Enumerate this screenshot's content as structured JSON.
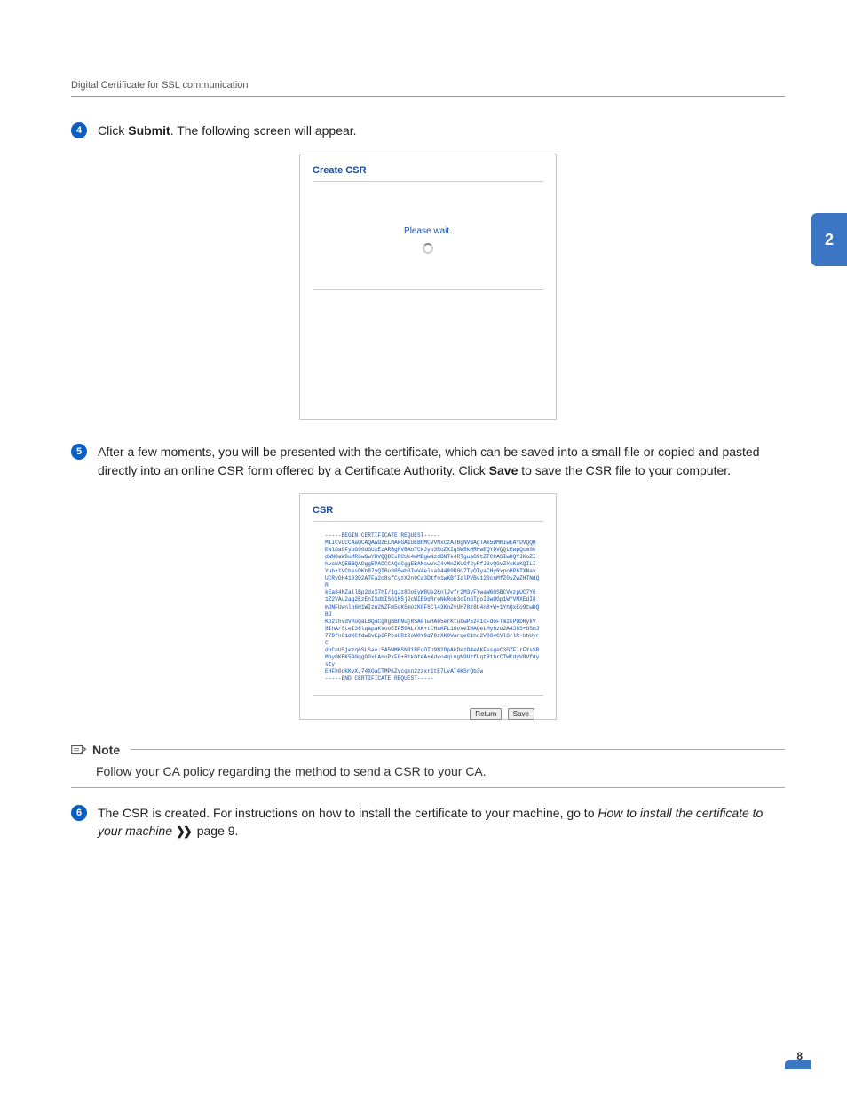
{
  "header": {
    "section_title": "Digital Certificate for SSL communication"
  },
  "side_tab": {
    "label": "2"
  },
  "steps": {
    "s4": {
      "num": "4",
      "pre": "Click ",
      "bold": "Submit",
      "post": ". The following screen will appear."
    },
    "s5": {
      "num": "5",
      "text_a": "After a few moments, you will be presented with the certificate, which can be saved into a small file or copied and pasted directly into an online CSR form offered by a Certificate Authority. Click ",
      "bold": "Save",
      "text_b": " to save the CSR file to your computer."
    },
    "s6": {
      "num": "6",
      "text_a": "The CSR is created. For instructions on how to install the certificate to your machine, go to ",
      "italic_a": "How to install the certificate to your machine",
      "post": " page 9."
    }
  },
  "screenshot1": {
    "title": "Create CSR",
    "wait": "Please wait."
  },
  "screenshot2": {
    "title": "CSR",
    "csr_lines": [
      "-----BEGIN CERTIFICATE REQUEST-----",
      "MIICvDCCAaQCAQAwdzELMAkGA1UEBhMCVVMxCzAJBgNVBAgTAk5DMRIwEAYDVQQH",
      "EwlDaGFybG90dGUxEzARBgNVBAoTCkJyb3RoZXIgSW5kMRMwEQYDVQQLEwpQcm9k",
      "dWN0aW9uMR0wGwYDVQQDExRCUk4wMDgwNzdBNTk4RTguaG9tZTCCASIwDQYJKoZI",
      "hvcNAQEBBQADggEPADCCAQoCggEBAMcwVxZ4vMnZKUGf2yRfJ3vQGvZYcKuKQILI",
      "Yuh+1VChesDKhB7yQIBo985wb3IwV4elsa94489R0U7TyOTyaCHyRxpoRP6TXNav",
      "UCRyGH4103D2ATFa2c8sfCyzX2n9Ca3Dtfn1wKBfIdlPVBv120cnMfZ0sZwZHTNdQR",
      "kEa84NZallBp2dxX7hI/1gJz8DoEyW8Ue2KnlJvfr2M3yFYwaW6OSBCVezpUC7Y6",
      "1Z2VAu2aq2EzEnISdbISG1M5j2cWIE9dRroNkRob3cInGTpoI3wUGp1WYVMXEdI8",
      "mDNFUwnlb6H1WIzn2NZFm5oK5mozK0F6Cl43KnZvUH78z8U4n8+W+1YhQxEo9twDQBJ",
      "Ko2IhvdVRoQaLBQaCg8gBBhNujRSA0lwHAb5erKtubwP5z41cFdoFTm2kPQDRykV",
      "8IhA/SteI36lqapaKVooEIP59ALrXK+tCHaKFL1OoVeIMAQeLMyhzo2A4J8S+USmJ",
      "77Dfn81dKCfdwBvEp6FPbsURt2oW0Y9d78zXK0VarqeC1hn2V084CVlGrlR+hhUyrC",
      "dpCnU5jezq6SLSae:5A5WMKSNR1BEoOTU9N2DpAkDezD4eAKFesgeC30ZFlrFYsSB",
      "Mby0KEK590qgG0xLAnoPxFG+81kOteA+Xdvo4qLmgN9UzfUqtR1hrCTWCdyV8Vfdysty",
      "EHFh0dKKvXJ74XOaCTMPKZvcqkn2zzxr1tE7LvAT4KSrQb3w",
      "-----END CERTIFICATE REQUEST-----"
    ],
    "btn_return": "Return",
    "btn_save": "Save"
  },
  "note": {
    "label": "Note",
    "text": "Follow your CA policy regarding the method to send a CSR to your CA."
  },
  "footer": {
    "page_num": "8"
  }
}
